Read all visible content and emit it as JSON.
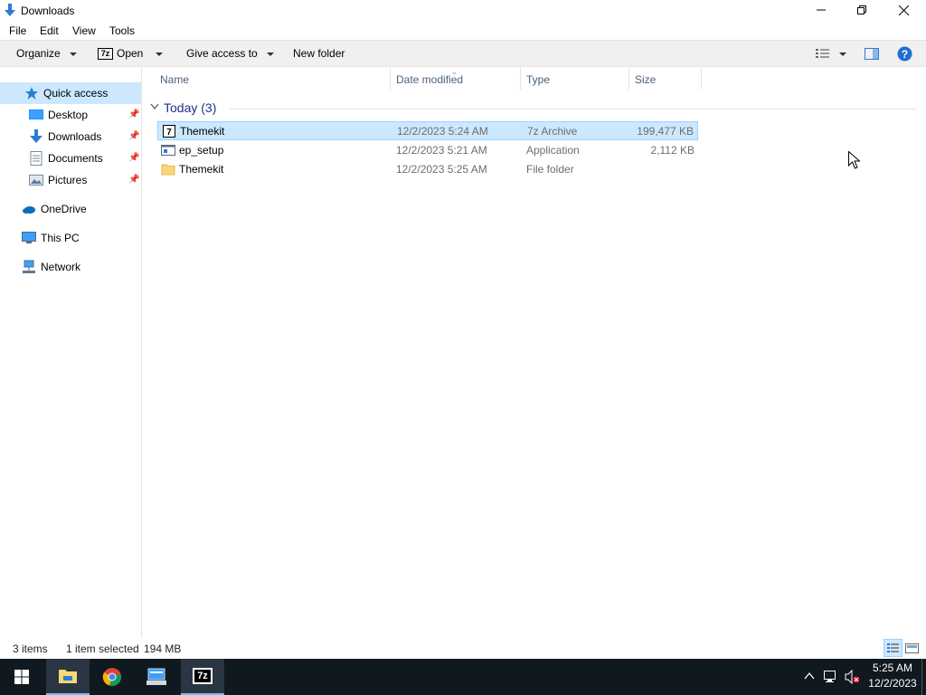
{
  "window": {
    "title": "Downloads",
    "minimize_icon": "minimize-icon",
    "restore_icon": "restore-icon",
    "close_icon": "close-icon"
  },
  "menu": {
    "items": [
      "File",
      "Edit",
      "View",
      "Tools"
    ]
  },
  "toolbar": {
    "organize": "Organize",
    "open": "Open",
    "open_badge": "7z",
    "give_access": "Give access to",
    "new_folder": "New folder"
  },
  "nav": {
    "quick_access": "Quick access",
    "desktop": "Desktop",
    "downloads": "Downloads",
    "documents": "Documents",
    "pictures": "Pictures",
    "onedrive": "OneDrive",
    "this_pc": "This PC",
    "network": "Network"
  },
  "columns": {
    "name": "Name",
    "date": "Date modified",
    "type": "Type",
    "size": "Size"
  },
  "group": {
    "title": "Today (3)"
  },
  "files": [
    {
      "name": "Themekit",
      "date": "12/2/2023 5:24 AM",
      "type": "7z Archive",
      "size": "199,477 KB"
    },
    {
      "name": "ep_setup",
      "date": "12/2/2023 5:21 AM",
      "type": "Application",
      "size": "2,112 KB"
    },
    {
      "name": "Themekit",
      "date": "12/2/2023 5:25 AM",
      "type": "File folder",
      "size": ""
    }
  ],
  "status": {
    "count": "3 items",
    "selected": "1 item selected",
    "size": "194 MB"
  },
  "taskbar": {
    "time": "5:25 AM",
    "date": "12/2/2023",
    "app_7z_label": "7z"
  },
  "colors": {
    "selection": "#cce8ff",
    "accent": "#0078d7",
    "taskbar": "#101820"
  }
}
